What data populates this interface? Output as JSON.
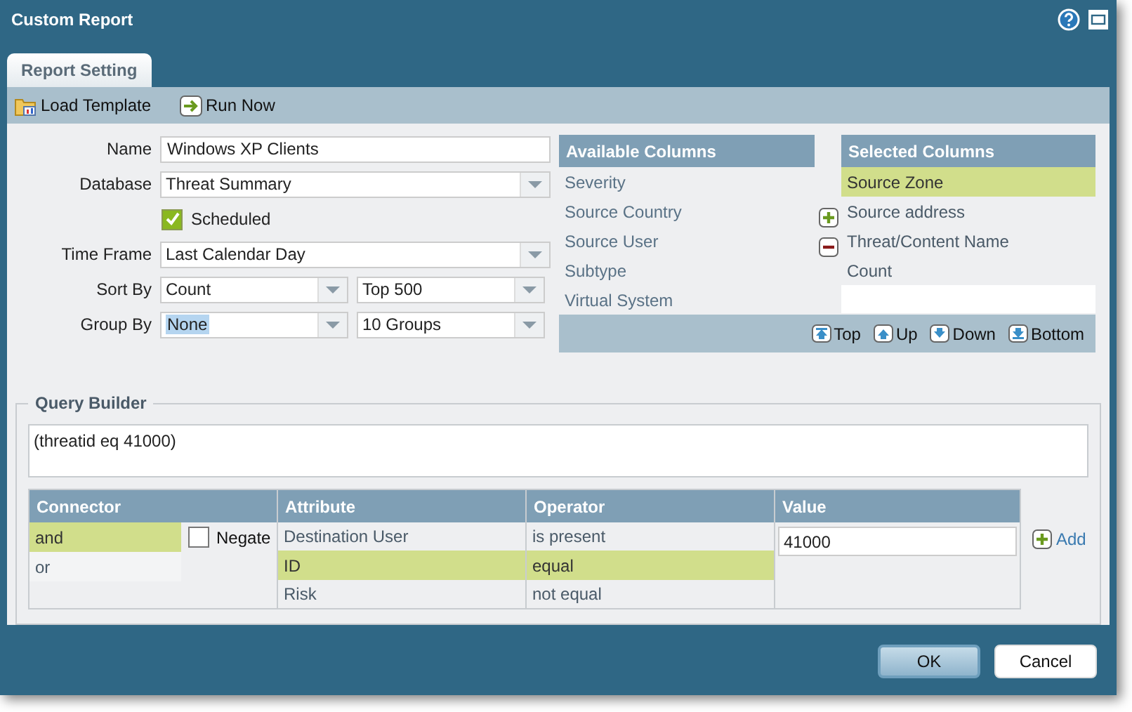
{
  "window": {
    "title": "Custom Report"
  },
  "tabs": [
    {
      "label": "Report Setting",
      "selected": true
    }
  ],
  "toolbar": [
    {
      "label": "Load Template",
      "kind": "folder"
    },
    {
      "label": "Run Now",
      "kind": "run"
    }
  ],
  "form": {
    "name": {
      "label": "Name",
      "value": "Windows XP Clients"
    },
    "database": {
      "label": "Database",
      "value": "Threat Summary"
    },
    "scheduled": {
      "label": "Scheduled",
      "checked": true
    },
    "time_frame": {
      "label": "Time Frame",
      "value": "Last Calendar Day"
    },
    "sort_by": {
      "label": "Sort By",
      "value": "Count",
      "limit": "Top 500"
    },
    "group_by": {
      "label": "Group By",
      "value": "None",
      "limit": "10 Groups"
    }
  },
  "available_columns": {
    "title": "Available Columns",
    "items": [
      {
        "label": "Severity",
        "selected": false
      },
      {
        "label": "Source Country",
        "selected": false
      },
      {
        "label": "Source User",
        "selected": false
      },
      {
        "label": "Subtype",
        "selected": false
      },
      {
        "label": "Virtual System",
        "selected": false
      }
    ]
  },
  "selected_columns": {
    "title": "Selected Columns",
    "items": [
      {
        "label": "Source Zone",
        "selected": true
      },
      {
        "label": "Source address",
        "selected": false
      },
      {
        "label": "Threat/Content Name",
        "selected": false
      },
      {
        "label": "Count",
        "selected": false
      }
    ]
  },
  "order_buttons": [
    {
      "label": "Top",
      "kind": "top"
    },
    {
      "label": "Up",
      "kind": "up"
    },
    {
      "label": "Down",
      "kind": "down"
    },
    {
      "label": "Bottom",
      "kind": "bottom"
    }
  ],
  "query_builder": {
    "title": "Query Builder",
    "query": "(threatid eq 41000)",
    "connector": {
      "title": "Connector",
      "items": [
        {
          "label": "and",
          "selected": true
        },
        {
          "label": "or",
          "selected": false
        }
      ],
      "negate": {
        "label": "Negate",
        "checked": false
      }
    },
    "attribute": {
      "title": "Attribute",
      "items": [
        {
          "label": "Destination User",
          "selected": false
        },
        {
          "label": "ID",
          "selected": true
        },
        {
          "label": "Risk",
          "selected": false
        }
      ]
    },
    "operator": {
      "title": "Operator",
      "items": [
        {
          "label": "is present",
          "selected": false
        },
        {
          "label": "equal",
          "selected": true
        },
        {
          "label": "not equal",
          "selected": false
        }
      ]
    },
    "value": {
      "title": "Value",
      "value": "41000"
    },
    "add": "Add"
  },
  "buttons": [
    {
      "label": "OK",
      "kind": "primary"
    },
    {
      "label": "Cancel",
      "kind": "secondary"
    }
  ]
}
